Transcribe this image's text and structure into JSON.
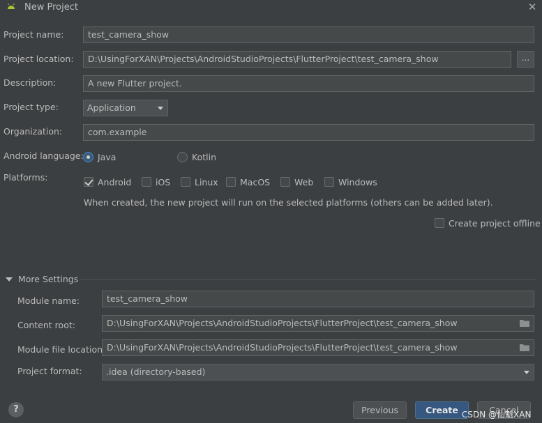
{
  "window": {
    "title": "New Project",
    "close_glyph": "✕"
  },
  "form": {
    "project_name_label": "Project name:",
    "project_name_value": "test_camera_show",
    "project_location_label": "Project location:",
    "project_location_value": "D:\\UsingForXAN\\Projects\\AndroidStudioProjects\\FlutterProject\\test_camera_show",
    "browse_label": "...",
    "description_label": "Description:",
    "description_value": "A new Flutter project.",
    "project_type_label": "Project type:",
    "project_type_value": "Application",
    "organization_label": "Organization:",
    "organization_value": "com.example",
    "android_language_label": "Android language:",
    "language_options": [
      "Java",
      "Kotlin"
    ],
    "language_selected": "Java",
    "platforms_label": "Platforms:",
    "platforms": [
      {
        "label": "Android",
        "checked": true
      },
      {
        "label": "iOS",
        "checked": false
      },
      {
        "label": "Linux",
        "checked": false
      },
      {
        "label": "MacOS",
        "checked": false
      },
      {
        "label": "Web",
        "checked": false
      },
      {
        "label": "Windows",
        "checked": false
      }
    ],
    "platforms_hint": "When created, the new project will run on the selected platforms (others can be added later).",
    "offline_label": "Create project offline",
    "offline_checked": false
  },
  "more_settings": {
    "header": "More Settings",
    "module_name_label": "Module name:",
    "module_name_value": "test_camera_show",
    "content_root_label": "Content root:",
    "content_root_value": "D:\\UsingForXAN\\Projects\\AndroidStudioProjects\\FlutterProject\\test_camera_show",
    "module_file_location_label": "Module file location:",
    "module_file_location_value": "D:\\UsingForXAN\\Projects\\AndroidStudioProjects\\FlutterProject\\test_camera_show",
    "project_format_label": "Project format:",
    "project_format_value": ".idea (directory-based)"
  },
  "footer": {
    "help_label": "?",
    "previous_label": "Previous",
    "create_label": "Create",
    "cancel_label": "Cancel",
    "watermark": "CSDN @仙魁XAN"
  },
  "colors": {
    "background": "#3c3f41",
    "field": "#45494a",
    "primary_button": "#365880",
    "android_green": "#a4c639"
  }
}
